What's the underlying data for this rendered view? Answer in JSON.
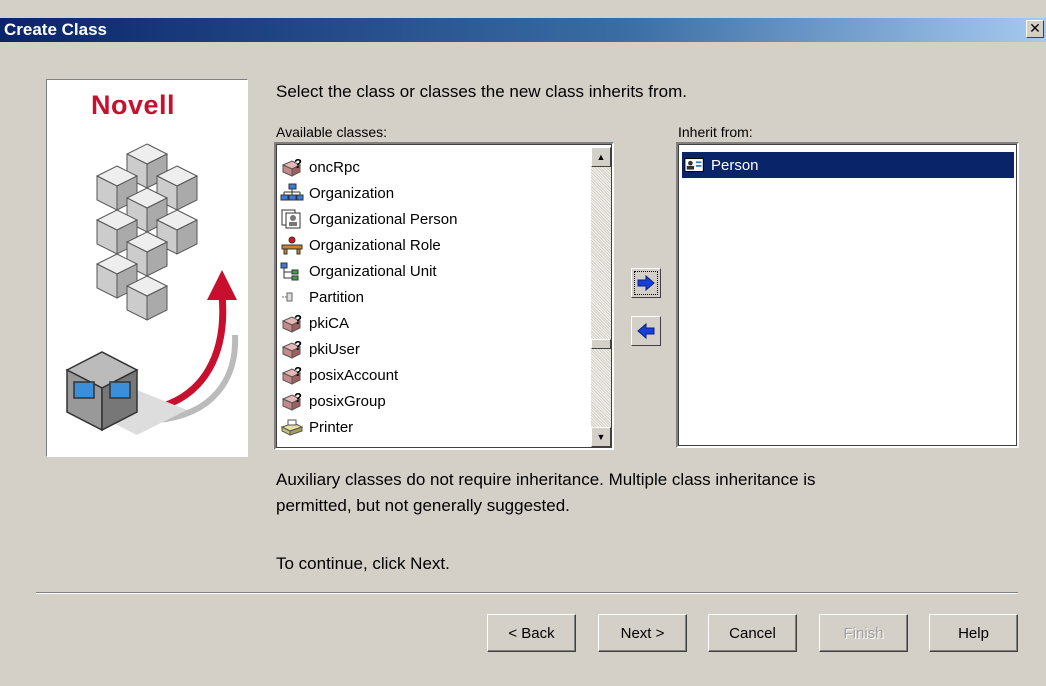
{
  "window": {
    "title": "Create Class",
    "close_glyph": "✕"
  },
  "brand": {
    "logo_text": "Novell"
  },
  "instruction": "Select the class or classes the new class inherits from.",
  "available": {
    "label": "Available classes:",
    "items": [
      {
        "label": "oncRpc",
        "icon": "unknown-class-icon"
      },
      {
        "label": "Organization",
        "icon": "organization-icon"
      },
      {
        "label": "Organizational Person",
        "icon": "organizational-person-icon"
      },
      {
        "label": "Organizational Role",
        "icon": "organizational-role-icon"
      },
      {
        "label": "Organizational Unit",
        "icon": "organizational-unit-icon"
      },
      {
        "label": "Partition",
        "icon": "partition-icon"
      },
      {
        "label": "pkiCA",
        "icon": "unknown-class-icon"
      },
      {
        "label": "pkiUser",
        "icon": "unknown-class-icon"
      },
      {
        "label": "posixAccount",
        "icon": "unknown-class-icon"
      },
      {
        "label": "posixGroup",
        "icon": "unknown-class-icon"
      },
      {
        "label": "Printer",
        "icon": "printer-icon"
      }
    ]
  },
  "inherit": {
    "label": "Inherit from:",
    "items": [
      {
        "label": "Person",
        "icon": "person-card-icon",
        "selected": true
      }
    ]
  },
  "info": {
    "line1": "Auxiliary classes do not require inheritance.  Multiple class inheritance is",
    "line2": "permitted, but not generally suggested.",
    "line3": "To continue, click Next."
  },
  "buttons": {
    "back": "< Back",
    "next": "Next >",
    "cancel": "Cancel",
    "finish": "Finish",
    "help": "Help"
  },
  "colors": {
    "title_gradient_start": "#0a246a",
    "selection": "#0a246a",
    "dialog_bg": "#d4d0c8",
    "novell_red": "#c8102e"
  }
}
